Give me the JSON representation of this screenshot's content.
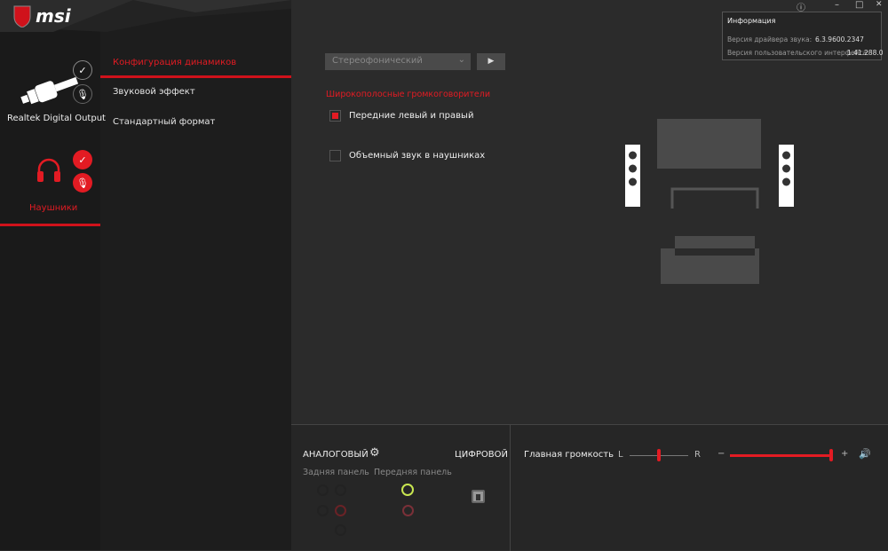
{
  "brand": {
    "logo": "msi"
  },
  "window_controls": {
    "info_icon": "info-icon",
    "minimize": "–",
    "maximize": "□",
    "close": "✕"
  },
  "info_panel": {
    "title": "Информация",
    "driver_label": "Версия драйвера звука:",
    "driver_value": "6.3.9600.2347",
    "ui_label": "Версия пользовательского интерфейса:",
    "ui_value": "1.41.288.0"
  },
  "devices": [
    {
      "label": "Realtek Digital Output",
      "active": false
    },
    {
      "label": "Наушники",
      "active": true
    }
  ],
  "nav": {
    "items": [
      {
        "label": "Конфигурация динамиков",
        "active": true
      },
      {
        "label": "Звуковой эффект"
      },
      {
        "label": "Стандартный формат"
      }
    ]
  },
  "main": {
    "speaker_select": "Стереофонический",
    "section_title": "Широкополосные громкоговорители",
    "options": [
      {
        "label": "Передние левый и правый",
        "checked": true
      },
      {
        "label": "Объемный звук в наушниках",
        "checked": false
      }
    ]
  },
  "bottom": {
    "analog": "АНАЛОГОВЫЙ",
    "digital": "ЦИФРОВОЙ",
    "rear": "Задняя панель",
    "front": "Передняя панель",
    "volume_label": "Главная громкость",
    "balance_left": "L",
    "balance_right": "R",
    "minus": "−",
    "plus": "+",
    "balance": 0.5,
    "volume": 1.0
  },
  "colors": {
    "accent": "#e31b23",
    "bg": "#2b2b2b",
    "jack_green": "#c8e650"
  }
}
